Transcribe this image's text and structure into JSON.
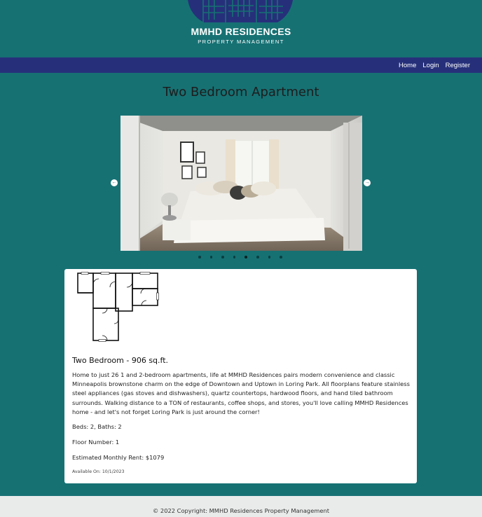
{
  "brand": {
    "name": "MMHD RESIDENCES",
    "subtitle": "PROPERTY MANAGEMENT"
  },
  "nav": {
    "home": "Home",
    "login": "Login",
    "register": "Register"
  },
  "page": {
    "title": "Two Bedroom Apartment"
  },
  "carousel": {
    "prev_label": "←",
    "next_label": "→",
    "slide_count": 8,
    "active_slide": 5
  },
  "listing": {
    "title": "Two Bedroom - 906 sq.ft.",
    "description": "Home to just 26 1 and 2-bedroom apartments, life at MMHD Residences pairs modern convenience and classic Minneapolis brownstone charm on the edge of Downtown and Uptown in Loring Park. All floorplans feature stainless steel appliances (gas stoves and dishwashers), quartz countertops, hardwood floors, and hand tiled bathroom surrounds. Walking distance to a TON of restaurants, coffee shops, and stores, you'll love calling MMHD Residences home - and let's not forget Loring Park is just around the corner!",
    "beds_baths": "Beds: 2, Baths: 2",
    "floor": "Floor Number: 1",
    "rent": "Estimated Monthly Rent: $1079",
    "available": "Available On: 10/1/2023"
  },
  "footer": {
    "copyright": "© 2022 Copyright: MMHD Residences Property Management"
  },
  "colors": {
    "background": "#167173",
    "navbar": "#26307a",
    "logo": "#26307a",
    "footer": "#e9eaea"
  }
}
